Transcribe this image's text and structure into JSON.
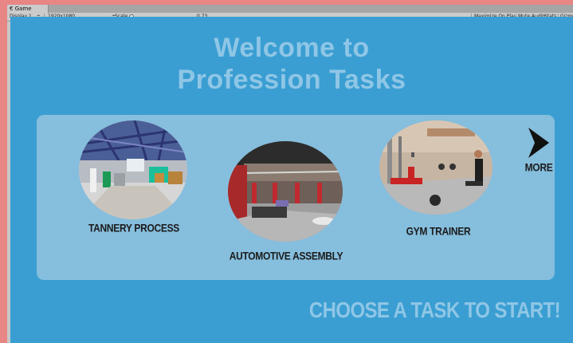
{
  "window": {
    "tab_title": "Game",
    "display": "Display 1",
    "resolution": "1920x1080",
    "scale_label": "Scale",
    "scale_value": "0.73",
    "maximize_on_play": "Maximize On Play",
    "mute_audio": "Mute Audio",
    "stats": "Stats",
    "gizmos": "Gizmos"
  },
  "game": {
    "title_line1": "Welcome to",
    "title_line2": "Profession Tasks",
    "tasks": [
      {
        "label": "TANNERY PROCESS"
      },
      {
        "label": "AUTOMOTIVE ASSEMBLY"
      },
      {
        "label": "GYM TRAINER"
      }
    ],
    "more_label": "MORE",
    "cta": "CHOOSE A TASK TO START!"
  },
  "colors": {
    "background": "#3a9ed2",
    "panel": "#86bedd",
    "title": "#8fc6e6",
    "label": "#1b1b1b",
    "frame": "#e88585"
  }
}
